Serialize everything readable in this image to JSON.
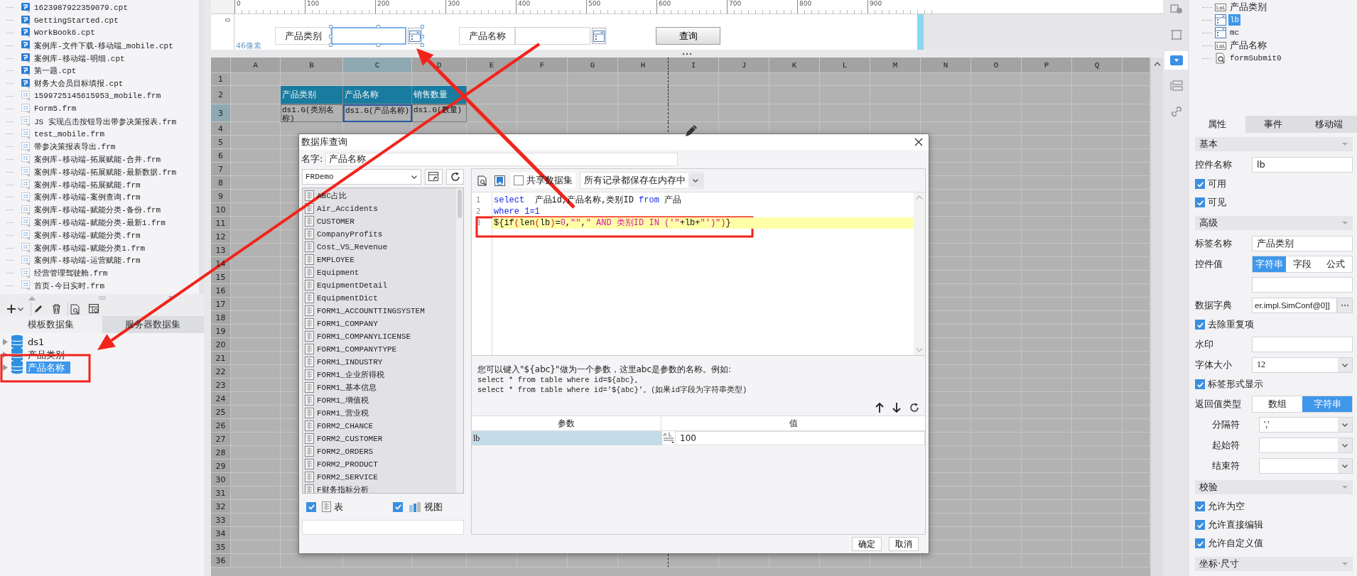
{
  "file_tree": {
    "items": [
      {
        "name": "1623987922359079.cpt",
        "kind": "cpt"
      },
      {
        "name": "GettingStarted.cpt",
        "kind": "cpt"
      },
      {
        "name": "WorkBook6.cpt",
        "kind": "cpt"
      },
      {
        "name": "案例库-文件下载-移动端_mobile.cpt",
        "kind": "cpt"
      },
      {
        "name": "案例库-移动端-明细.cpt",
        "kind": "cpt"
      },
      {
        "name": "第一题.cpt",
        "kind": "cpt"
      },
      {
        "name": "财务大会员目标填报.cpt",
        "kind": "cpt"
      },
      {
        "name": "1599725145615953_mobile.frm",
        "kind": "frm"
      },
      {
        "name": "Form5.frm",
        "kind": "frm"
      },
      {
        "name": "JS 实现点击按钮导出带参决策报表.frm",
        "kind": "frm"
      },
      {
        "name": "test_mobile.frm",
        "kind": "frm"
      },
      {
        "name": "带参决策报表导出.frm",
        "kind": "frm"
      },
      {
        "name": "案例库-移动端-拓展赋能-合并.frm",
        "kind": "frm"
      },
      {
        "name": "案例库-移动端-拓展赋能-最新数据.frm",
        "kind": "frm"
      },
      {
        "name": "案例库-移动端-拓展赋能.frm",
        "kind": "frm"
      },
      {
        "name": "案例库-移动端-案例查询.frm",
        "kind": "frm"
      },
      {
        "name": "案例库-移动端-赋能分类-备份.frm",
        "kind": "frm"
      },
      {
        "name": "案例库-移动端-赋能分类-最新1.frm",
        "kind": "frm"
      },
      {
        "name": "案例库-移动端-赋能分类.frm",
        "kind": "frm"
      },
      {
        "name": "案例库-移动端-赋能分类1.frm",
        "kind": "frm"
      },
      {
        "name": "案例库-移动端-运营赋能.frm",
        "kind": "frm"
      },
      {
        "name": "经营管理驾驶舱.frm",
        "kind": "frm"
      },
      {
        "name": "首页-今日实时.frm",
        "kind": "frm"
      }
    ]
  },
  "dataset_panel": {
    "tabs": [
      {
        "label": "模板数据集",
        "selected": true
      },
      {
        "label": "服务器数据集",
        "selected": false
      }
    ],
    "datasets": [
      {
        "name": "ds1",
        "selected": false
      },
      {
        "name": "产品类别",
        "selected": false
      },
      {
        "name": "产品名称",
        "selected": true
      }
    ]
  },
  "ruler": {
    "ticks": [
      "0",
      "100",
      "200",
      "300",
      "400",
      "500",
      "600",
      "700",
      "800",
      "900"
    ],
    "vertical_tick": "0"
  },
  "form": {
    "height_label": "46像素",
    "widgets": [
      {
        "kind": "label",
        "text": "产品类别"
      },
      {
        "kind": "combo",
        "selected": true
      },
      {
        "kind": "label",
        "text": "产品名称"
      },
      {
        "kind": "combo",
        "selected": false
      },
      {
        "kind": "button",
        "text": "查询"
      }
    ]
  },
  "sheet": {
    "columns": [
      {
        "label": "A",
        "selected": false
      },
      {
        "label": "B",
        "selected": false
      },
      {
        "label": "C",
        "selected": true
      },
      {
        "label": "D",
        "selected": false
      },
      {
        "label": "E",
        "selected": false
      },
      {
        "label": "F",
        "selected": false
      },
      {
        "label": "G",
        "selected": false
      },
      {
        "label": "H",
        "selected": false
      },
      {
        "label": "I",
        "selected": false
      },
      {
        "label": "J",
        "selected": false
      },
      {
        "label": "K",
        "selected": false
      },
      {
        "label": "L",
        "selected": false
      },
      {
        "label": "M",
        "selected": false
      },
      {
        "label": "N",
        "selected": false
      },
      {
        "label": "O",
        "selected": false
      },
      {
        "label": "P",
        "selected": false
      },
      {
        "label": "Q",
        "selected": false
      }
    ],
    "rows": [
      {
        "label": "1",
        "selected": false
      },
      {
        "label": "2",
        "selected": false
      },
      {
        "label": "3",
        "selected": true
      },
      {
        "label": "4",
        "selected": false
      },
      {
        "label": "5",
        "selected": false
      },
      {
        "label": "6",
        "selected": false
      },
      {
        "label": "7",
        "selected": false
      },
      {
        "label": "8",
        "selected": false
      },
      {
        "label": "9",
        "selected": false
      },
      {
        "label": "10",
        "selected": false
      },
      {
        "label": "11",
        "selected": false
      },
      {
        "label": "12",
        "selected": false
      },
      {
        "label": "13",
        "selected": false
      },
      {
        "label": "14",
        "selected": false
      },
      {
        "label": "15",
        "selected": false
      },
      {
        "label": "16",
        "selected": false
      },
      {
        "label": "17",
        "selected": false
      },
      {
        "label": "18",
        "selected": false
      },
      {
        "label": "19",
        "selected": false
      },
      {
        "label": "20",
        "selected": false
      },
      {
        "label": "21",
        "selected": false
      },
      {
        "label": "22",
        "selected": false
      },
      {
        "label": "23",
        "selected": false
      },
      {
        "label": "24",
        "selected": false
      },
      {
        "label": "25",
        "selected": false
      },
      {
        "label": "26",
        "selected": false
      },
      {
        "label": "27",
        "selected": false
      },
      {
        "label": "28",
        "selected": false
      },
      {
        "label": "29",
        "selected": false
      },
      {
        "label": "30",
        "selected": false
      },
      {
        "label": "31",
        "selected": false
      },
      {
        "label": "32",
        "selected": false
      },
      {
        "label": "33",
        "selected": false
      },
      {
        "label": "34",
        "selected": false
      },
      {
        "label": "35",
        "selected": false
      },
      {
        "label": "36",
        "selected": false
      }
    ],
    "report_block": {
      "headers": [
        "产品类别",
        "产品名称",
        "销售数量"
      ],
      "cells": [
        {
          "text": "ds1.G(类别名称)",
          "selected": false
        },
        {
          "text": "ds1.G(产品名称)",
          "selected": true
        },
        {
          "text": "ds1.G(数量)",
          "selected": false
        }
      ]
    }
  },
  "dialog": {
    "title": "数据库查询",
    "name_label": "名字:",
    "name_value": "产品名称",
    "datasource": "FRDemo",
    "tables": [
      "ABC占比",
      "Air_Accidents",
      "CUSTOMER",
      "CompanyProfits",
      "Cost_VS_Revenue",
      "EMPLOYEE",
      "Equipment",
      "EquipmentDetail",
      "EquipmentDict",
      "FORM1_ACCOUNTTINGSYSTEM",
      "FORM1_COMPANY",
      "FORM1_COMPANYLICENSE",
      "FORM1_COMPANYTYPE",
      "FORM1_INDUSTRY",
      "FORM1_企业所得税",
      "FORM1_基本信息",
      "FORM1_增值税",
      "FORM1_营业税",
      "FORM2_CHANCE",
      "FORM2_CUSTOMER",
      "FORM2_ORDERS",
      "FORM2_PRODUCT",
      "FORM2_SERVICE",
      "F财务指标分析"
    ],
    "filters": [
      {
        "label": "表",
        "kind": "table",
        "checked": true
      },
      {
        "label": "视图",
        "kind": "view",
        "checked": true
      }
    ],
    "share": {
      "label": "共享数据集",
      "checked": false
    },
    "cache_mode": "所有记录都保存在内存中",
    "sql_lines": [
      {
        "number": "1",
        "highlighted": false,
        "tokens": [
          {
            "kind": "keyword",
            "text": "select"
          },
          {
            "kind": "plain",
            "text": "  产品id,产品名称,类别ID "
          },
          {
            "kind": "keyword",
            "text": "from"
          },
          {
            "kind": "plain",
            "text": " 产品"
          }
        ]
      },
      {
        "number": "2",
        "highlighted": false,
        "tokens": [
          {
            "kind": "keyword",
            "text": "where"
          },
          {
            "kind": "keyword",
            "text": " 1=1"
          }
        ]
      },
      {
        "number": "3",
        "highlighted": true,
        "tokens": [
          {
            "kind": "plain",
            "text": "${if"
          },
          {
            "kind": "paren",
            "text": "("
          },
          {
            "kind": "plain",
            "text": "len"
          },
          {
            "kind": "paren",
            "text": "("
          },
          {
            "kind": "plain",
            "text": "lb"
          },
          {
            "kind": "paren",
            "text": ")"
          },
          {
            "kind": "plain",
            "text": "="
          },
          {
            "kind": "string",
            "text": "0"
          },
          {
            "kind": "plain",
            "text": ","
          },
          {
            "kind": "string",
            "text": "\"\""
          },
          {
            "kind": "plain",
            "text": ","
          },
          {
            "kind": "string",
            "text": "\" AND 类别ID IN ('\""
          },
          {
            "kind": "plain",
            "text": "+lb+"
          },
          {
            "kind": "string",
            "text": "\"')\""
          },
          {
            "kind": "paren",
            "text": ")"
          },
          {
            "kind": "plain",
            "text": "}"
          }
        ]
      }
    ],
    "hints": [
      "您可以键入\"${abc}\"做为一个参数，这里abc是参数的名称。例如:",
      "select * from table where id=${abc}。",
      "select * from table where id='${abc}'。(如果id字段为字符串类型)"
    ],
    "params": {
      "columns": [
        "参数",
        "值"
      ],
      "rows": [
        {
          "name": "lb",
          "value": "100",
          "selected": true
        }
      ]
    },
    "buttons": [
      "确定",
      "取消"
    ]
  },
  "tool_strip": [
    {
      "kind": "info",
      "selected": false
    },
    {
      "kind": "frame",
      "selected": false
    },
    {
      "kind": "combo",
      "selected": true
    },
    {
      "kind": "layout",
      "selected": false
    },
    {
      "kind": "link",
      "selected": false
    }
  ],
  "widget_tree": [
    {
      "name": "产品类别",
      "kind": "label",
      "selected": false
    },
    {
      "name": "lb",
      "kind": "combo",
      "selected": true
    },
    {
      "name": "mc",
      "kind": "combo",
      "selected": false
    },
    {
      "name": "产品名称",
      "kind": "label",
      "selected": false
    },
    {
      "name": "formSubmit0",
      "kind": "submit",
      "selected": false
    }
  ],
  "property_tabs": [
    {
      "label": "属性",
      "selected": true
    },
    {
      "label": "事件",
      "selected": false
    },
    {
      "label": "移动端",
      "selected": false
    }
  ],
  "sections": [
    {
      "title": "基本",
      "rows": [
        {
          "kind": "text",
          "label": "控件名称",
          "value": "lb"
        },
        {
          "kind": "check",
          "label": "可用",
          "checked": true
        },
        {
          "kind": "check",
          "label": "可见",
          "checked": true
        }
      ]
    },
    {
      "title": "高级",
      "rows": [
        {
          "kind": "text",
          "label": "标签名称",
          "value": "产品类别"
        },
        {
          "kind": "segmented",
          "label": "控件值",
          "options": [
            {
              "label": "字符串",
              "selected": true
            },
            {
              "label": "字段",
              "selected": false
            },
            {
              "label": "公式",
              "selected": false
            }
          ]
        },
        {
          "kind": "blank_field"
        },
        {
          "kind": "dict",
          "label": "数据字典",
          "value": "er.impl.SimConf@0]]"
        },
        {
          "kind": "check",
          "label": "去除重复项",
          "checked": true
        },
        {
          "kind": "text",
          "label": "水印"
        },
        {
          "kind": "select",
          "label": "字体大小",
          "value": "12"
        },
        {
          "kind": "check",
          "label": "标签形式显示",
          "checked": true
        },
        {
          "kind": "segmented",
          "label": "返回值类型",
          "options": [
            {
              "label": "数组",
              "selected": false
            },
            {
              "label": "字符串",
              "selected": true
            }
          ]
        },
        {
          "kind": "sub_select",
          "label": "分隔符",
          "value": "','"
        },
        {
          "kind": "sub_select",
          "label": "起始符"
        },
        {
          "kind": "sub_select",
          "label": "结束符"
        }
      ]
    },
    {
      "title": "校验",
      "rows": [
        {
          "kind": "check",
          "label": "允许为空",
          "checked": true
        },
        {
          "kind": "check",
          "label": "允许直接编辑",
          "checked": true
        },
        {
          "kind": "check",
          "label": "允许自定义值",
          "checked": true
        }
      ]
    },
    {
      "title": "坐标·尺寸"
    }
  ]
}
